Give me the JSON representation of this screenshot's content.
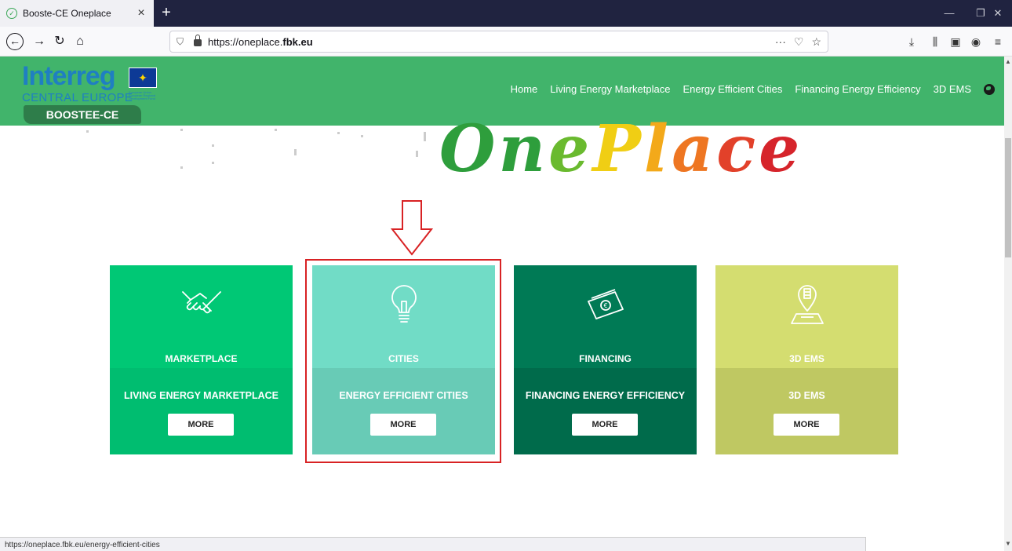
{
  "browser": {
    "tab_title": "Booste-CE Oneplace",
    "url_prefix": "https://oneplace.",
    "url_domain": "fbk.eu",
    "status_url": "https://oneplace.fbk.eu/energy-efficient-cities"
  },
  "site": {
    "logo": {
      "name": "Interreg",
      "region": "CENTRAL EUROPE",
      "project": "BOOSTEE-CE",
      "eu_text": "European Union European Regional Development Fund"
    },
    "nav": [
      {
        "label": "Home"
      },
      {
        "label": "Living Energy Marketplace"
      },
      {
        "label": "Energy Efficient Cities"
      },
      {
        "label": "Financing Energy Efficiency"
      },
      {
        "label": "3D EMS"
      }
    ],
    "hero_letters": [
      {
        "ch": "O",
        "color": "#2e9e3c"
      },
      {
        "ch": "n",
        "color": "#2e9e3c"
      },
      {
        "ch": "e",
        "color": "#6aba2f"
      },
      {
        "ch": "P",
        "color": "#f0ce14"
      },
      {
        "ch": "l",
        "color": "#f3a91a"
      },
      {
        "ch": "a",
        "color": "#ee7622"
      },
      {
        "ch": "c",
        "color": "#e2412a"
      },
      {
        "ch": "e",
        "color": "#d6242b"
      }
    ]
  },
  "cards": [
    {
      "category": "MARKETPLACE",
      "title": "LIVING ENERGY MARKETPLACE",
      "button": "MORE",
      "icon": "handshake-icon",
      "top_color": "#00c875",
      "bottom_color": "#00bd70"
    },
    {
      "category": "CITIES",
      "title": "ENERGY EFFICIENT CITIES",
      "button": "MORE",
      "icon": "lightbulb-icon",
      "top_color": "#71dcc6",
      "bottom_color": "#68cbb6"
    },
    {
      "category": "FINANCING",
      "title": "FINANCING ENERGY EFFICIENCY",
      "button": "MORE",
      "icon": "money-icon",
      "top_color": "#007a55",
      "bottom_color": "#006b4b"
    },
    {
      "category": "3D EMS",
      "title": "3D EMS",
      "button": "MORE",
      "icon": "map-pin-icon",
      "top_color": "#d4dd70",
      "bottom_color": "#bfc862"
    }
  ]
}
